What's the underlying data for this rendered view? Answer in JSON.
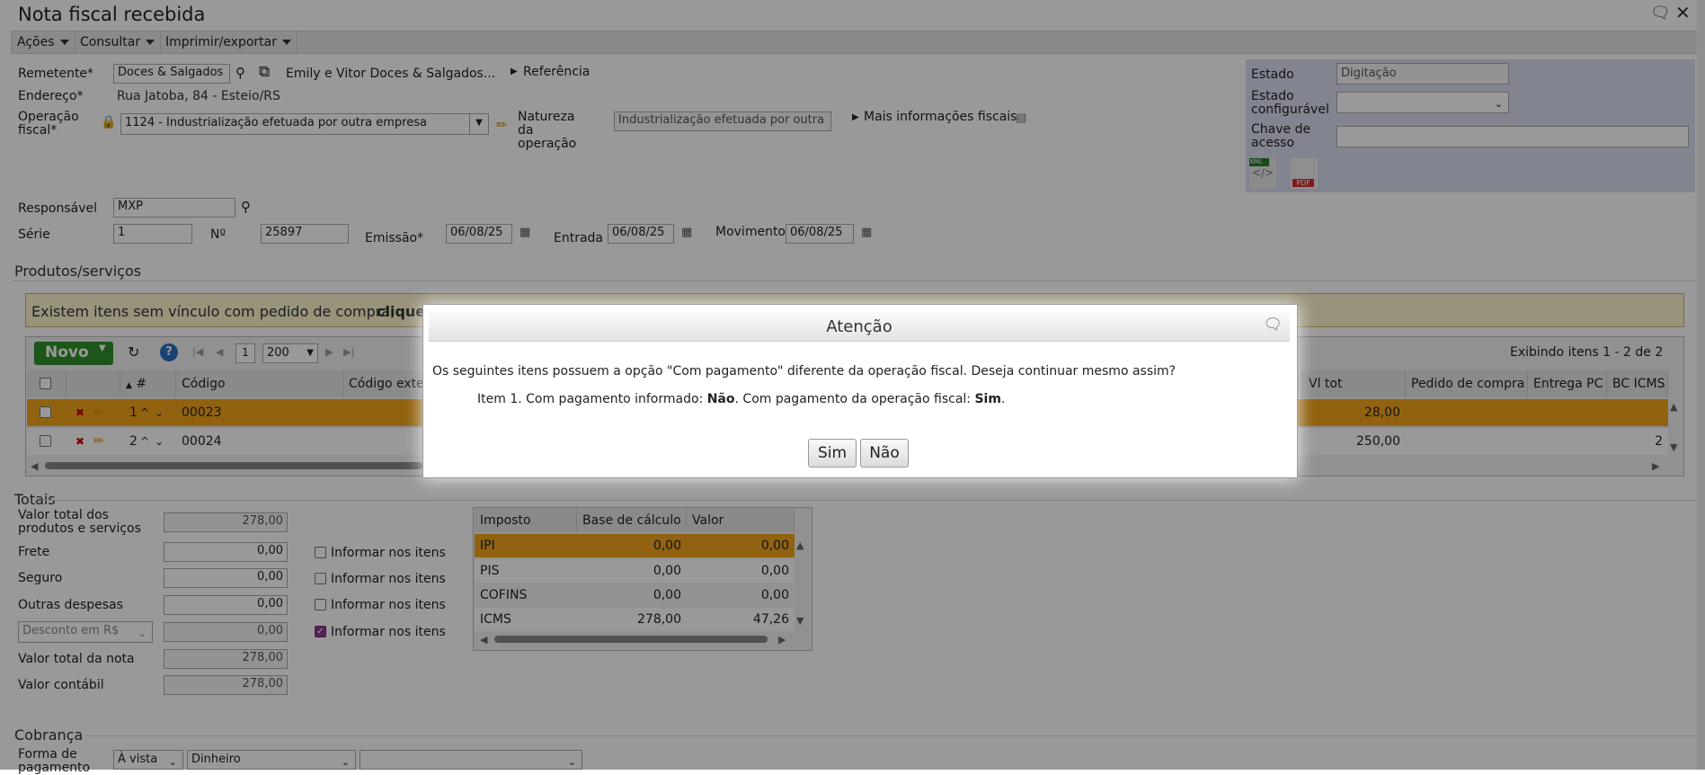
{
  "window": {
    "title": "Nota fiscal recebida"
  },
  "menu": [
    {
      "label": "Ações"
    },
    {
      "label": "Consultar"
    },
    {
      "label": "Imprimir/exportar"
    }
  ],
  "form": {
    "remetente_label": "Remetente*",
    "remetente_value": "Doces & Salgados",
    "remetente_name": "Emily e Vitor Doces & Salgados...",
    "referencia": "Referência",
    "endereco_label": "Endereço*",
    "endereco_value": "Rua Jatoba, 84 - Esteio/RS",
    "operacao_label": "Operação fiscal*",
    "operacao_value": "1124 - Industrialização efetuada por outra empresa",
    "natureza_label": "Natureza da operação",
    "natureza_value": "Industrialização efetuada por outra",
    "mais_info": "Mais informações fiscais",
    "responsavel_label": "Responsável",
    "responsavel_value": "MXP",
    "serie_label": "Série",
    "serie_value": "1",
    "numero_label": "Nº",
    "numero_value": "25897",
    "emissao_label": "Emissão*",
    "emissao_value": "06/08/25",
    "entrada_label": "Entrada",
    "entrada_value": "06/08/25",
    "movimento_label": "Movimento",
    "movimento_value": "06/08/25"
  },
  "right_panel": {
    "estado_label": "Estado",
    "estado_value": "Digitação",
    "estado_conf_label": "Estado configurável",
    "estado_conf_value": "",
    "chave_label": "Chave de acesso",
    "chave_value": ""
  },
  "produtos": {
    "section_title": "Produtos/serviços",
    "warning_text": "Existem itens sem vínculo com pedido de compra,",
    "warning_link": "clique",
    "novo_label": "Novo",
    "page": "1",
    "page_size": "200",
    "exibindo": "Exibindo itens 1 - 2 de 2",
    "columns": [
      "#",
      "Código",
      "Código exte",
      "Vl tot",
      "Pedido de compra",
      "Entrega PC",
      "BC ICMS"
    ],
    "rows": [
      {
        "n": "1",
        "codigo": "00023",
        "vl_tot": "28,00",
        "bc": ""
      },
      {
        "n": "2",
        "codigo": "00024",
        "vl_tot": "250,00",
        "bc": "2"
      }
    ]
  },
  "totais": {
    "section_title": "Totais",
    "valor_total_label": "Valor total dos produtos e serviços",
    "valor_total_value": "278,00",
    "frete_label": "Frete",
    "frete_value": "0,00",
    "seguro_label": "Seguro",
    "seguro_value": "0,00",
    "outras_label": "Outras despesas",
    "outras_value": "0,00",
    "desconto_select": "Desconto em R$",
    "desconto_value": "0,00",
    "valor_nota_label": "Valor total da nota",
    "valor_nota_value": "278,00",
    "valor_contabil_label": "Valor contábil",
    "valor_contabil_value": "278,00",
    "informar_label": "Informar nos itens",
    "informar_checked": [
      false,
      false,
      false,
      true
    ],
    "impostos_headers": [
      "Imposto",
      "Base de cálculo",
      "Valor"
    ],
    "impostos": [
      {
        "nome": "IPI",
        "base": "0,00",
        "valor": "0,00"
      },
      {
        "nome": "PIS",
        "base": "0,00",
        "valor": "0,00"
      },
      {
        "nome": "COFINS",
        "base": "0,00",
        "valor": "0,00"
      },
      {
        "nome": "ICMS",
        "base": "278,00",
        "valor": "47,26"
      }
    ]
  },
  "cobranca": {
    "section_title": "Cobrança",
    "forma_label": "Forma de pagamento",
    "forma_value": "À vista",
    "meio_value": "Dinheiro",
    "extra_value": ""
  },
  "dialog": {
    "title": "Atenção",
    "message": "Os seguintes itens possuem a opção \"Com pagamento\" diferente da operação fiscal. Deseja continuar mesmo assim?",
    "item_prefix": "Item 1. Com pagamento informado: ",
    "item_informado": "Não",
    "item_middle": ". Com pagamento da operação fiscal: ",
    "item_operacao": "Sim",
    "item_suffix": ".",
    "yes_label": "Sim",
    "no_label": "Não"
  },
  "colors": {
    "highlight_row": "#f2a31a",
    "panel": "#d9dcef",
    "green": "#2f8f2a"
  }
}
